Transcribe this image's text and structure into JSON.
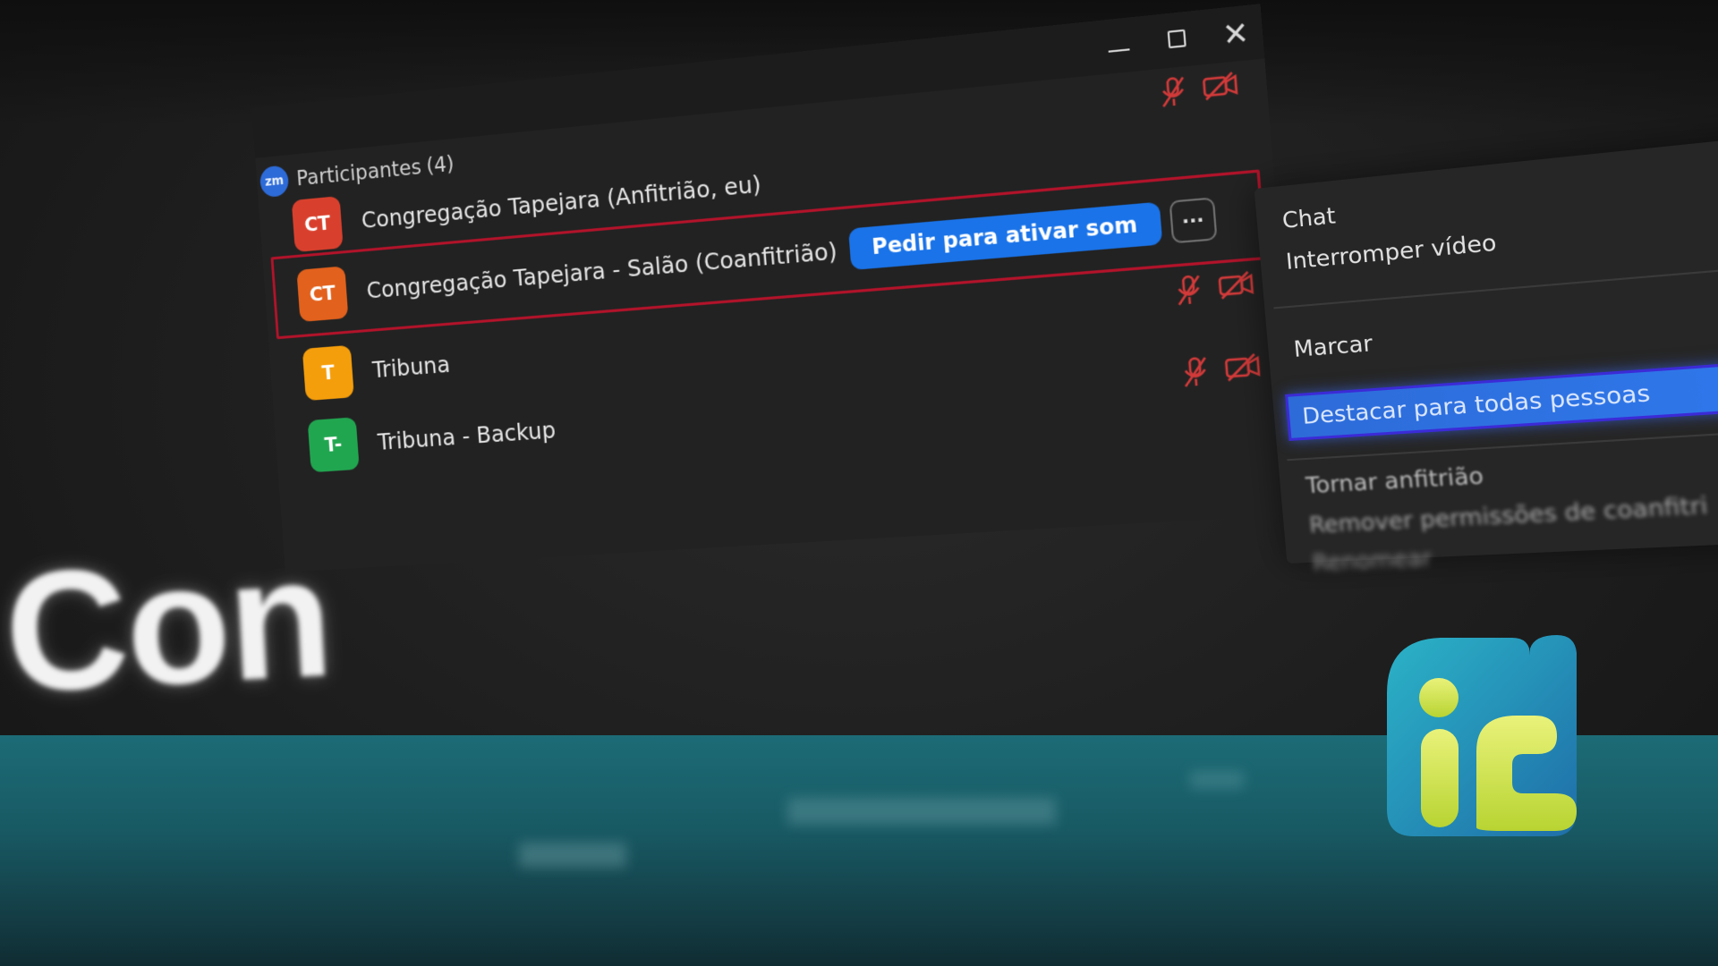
{
  "window": {
    "minimize_icon": "minimize-icon",
    "maximize_icon": "maximize-icon",
    "close_icon": "close-icon"
  },
  "header": {
    "logo_text": "zm",
    "title": "Participantes",
    "count": "(4)"
  },
  "participants": [
    {
      "initials": "CT",
      "name": "Congregação Tapejara (Anfitrião, eu)",
      "avatar_color": "#d8402d"
    },
    {
      "initials": "CT",
      "name": "Congregação Tapejara - Salão (Coanfitrião)",
      "avatar_color": "#e2611c",
      "ask_label": "Pedir para ativar som",
      "more_label": "···"
    },
    {
      "initials": "T",
      "name": "Tribuna",
      "avatar_color": "#f59e0b"
    },
    {
      "initials": "T-",
      "name": "Tribuna - Backup",
      "avatar_color": "#21a650"
    }
  ],
  "menu": {
    "items": [
      "Chat",
      "Interromper vídeo",
      "Marcar",
      "Destacar para todas pessoas",
      "Tornar anfitrião",
      "Remover permissões de coanfitri",
      "Renomear"
    ]
  },
  "overlay": {
    "big_text": "Con"
  },
  "colors": {
    "highlight_red": "#b3132a",
    "accent_blue": "#1a73e8",
    "muted_icon_red": "#d23a3a",
    "teal": "#1c6b76"
  },
  "icons": {
    "muted_mic": "muted-mic-icon",
    "video_off": "video-off-icon"
  }
}
